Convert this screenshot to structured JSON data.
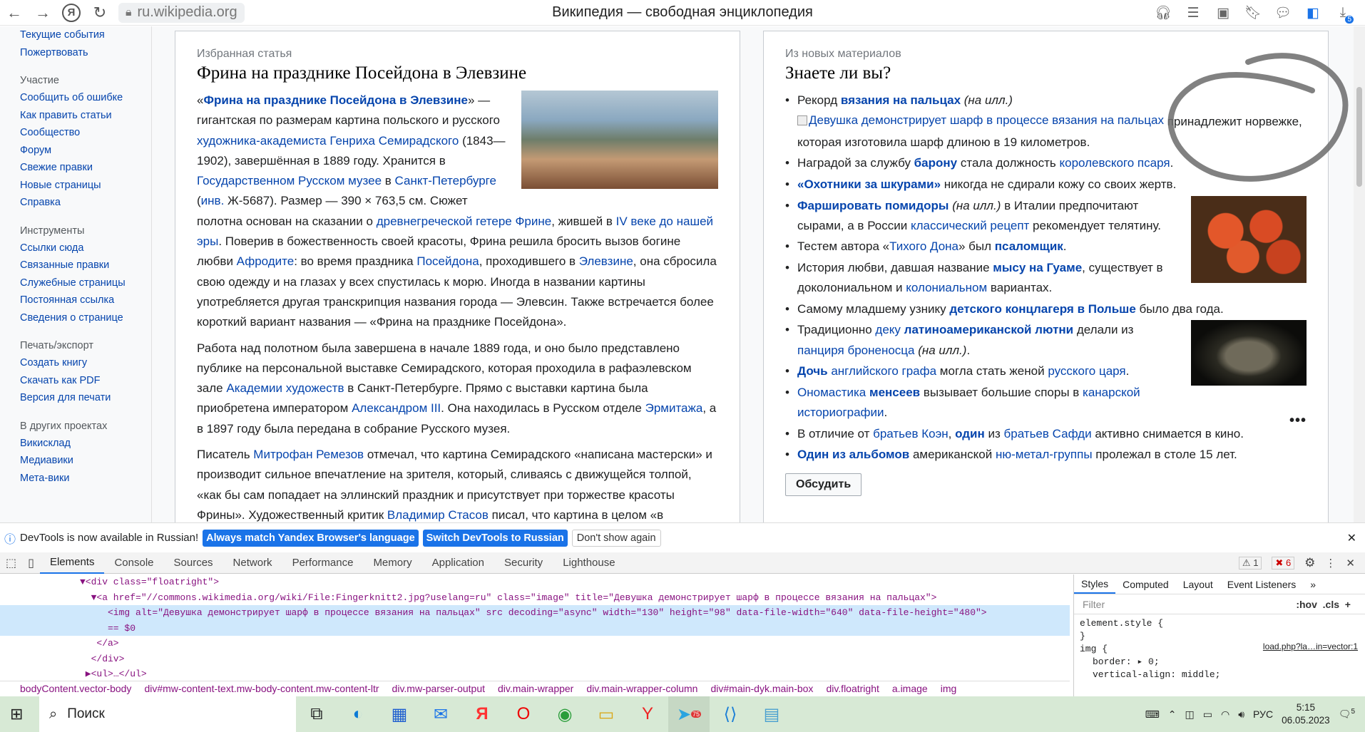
{
  "browser": {
    "url": "ru.wikipedia.org",
    "title": "Википедия — свободная энциклопедия",
    "downloads_badge": "5"
  },
  "sidebar": [
    {
      "type": "item",
      "label": "Текущие события"
    },
    {
      "type": "item",
      "label": "Пожертвовать"
    },
    {
      "type": "head",
      "label": "Участие"
    },
    {
      "type": "item",
      "label": "Сообщить об ошибке"
    },
    {
      "type": "item",
      "label": "Как править статьи"
    },
    {
      "type": "item",
      "label": "Сообщество"
    },
    {
      "type": "item",
      "label": "Форум"
    },
    {
      "type": "item",
      "label": "Свежие правки"
    },
    {
      "type": "item",
      "label": "Новые страницы"
    },
    {
      "type": "item",
      "label": "Справка"
    },
    {
      "type": "head",
      "label": "Инструменты"
    },
    {
      "type": "item",
      "label": "Ссылки сюда"
    },
    {
      "type": "item",
      "label": "Связанные правки"
    },
    {
      "type": "item",
      "label": "Служебные страницы"
    },
    {
      "type": "item",
      "label": "Постоянная ссылка"
    },
    {
      "type": "item",
      "label": "Сведения о странице"
    },
    {
      "type": "head",
      "label": "Печать/экспорт"
    },
    {
      "type": "item",
      "label": "Создать книгу"
    },
    {
      "type": "item",
      "label": "Скачать как PDF"
    },
    {
      "type": "item",
      "label": "Версия для печати"
    },
    {
      "type": "head",
      "label": "В других проектах"
    },
    {
      "type": "item",
      "label": "Викисклад"
    },
    {
      "type": "item",
      "label": "Медиавики"
    },
    {
      "type": "item",
      "label": "Мета-вики"
    }
  ],
  "featured": {
    "kicker": "Избранная статья",
    "title": "Фрина на празднике Посейдона в Элевзине",
    "paragraphs": [
      [
        {
          "t": "«"
        },
        {
          "b": "Фрина на празднике Посейдона в Элевзине"
        },
        {
          "t": "» — гигантская по размерам картина польского и русского "
        },
        {
          "a": "художника-академиста"
        },
        {
          "t": " "
        },
        {
          "a": "Генриха Семирадского"
        },
        {
          "t": " (1843—1902), завершённая в 1889 году. Хранится в "
        },
        {
          "a": "Государственном Русском музее"
        },
        {
          "t": " в "
        },
        {
          "a": "Санкт-Петербурге"
        },
        {
          "t": " ("
        },
        {
          "a": "инв."
        },
        {
          "t": " Ж-5687). Размер — 390 × 763,5 см. Сюжет полотна основан на сказании о "
        },
        {
          "a": "древнегреческой гетере Фрине"
        },
        {
          "t": ", жившей в "
        },
        {
          "a": "IV веке до нашей эры"
        },
        {
          "t": ". Поверив в божественность своей красоты, Фрина решила бросить вызов богине любви "
        },
        {
          "a": "Афродите"
        },
        {
          "t": ": во время праздника "
        },
        {
          "a": "Посейдона"
        },
        {
          "t": ", проходившего в "
        },
        {
          "a": "Элевзине"
        },
        {
          "t": ", она сбросила свою одежду и на глазах у всех спустилась к морю. Иногда в названии картины употребляется другая транскрипция названия города — Элевсин. Также встречается более короткий вариант названия — «Фрина на празднике Посейдона»."
        }
      ],
      [
        {
          "t": "Работа над полотном была завершена в начале 1889 года, и оно было представлено публике на персональной выставке Семирадского, которая проходила в рафаэлевском зале "
        },
        {
          "a": "Академии художеств"
        },
        {
          "t": " в Санкт-Петербурге. Прямо с выставки картина была приобретена императором "
        },
        {
          "a": "Александром III"
        },
        {
          "t": ". Она находилась в Русском отделе "
        },
        {
          "a": "Эрмитажа"
        },
        {
          "t": ", а в 1897 году была передана в собрание Русского музея."
        }
      ],
      [
        {
          "t": "Писатель "
        },
        {
          "a": "Митрофан Ремезов"
        },
        {
          "t": " отмечал, что картина Семирадского «написана мастерски» и производит сильное впечатление на зрителя, который, сливаясь с движущейся толпой, «как бы сам попадает на эллинский праздник и присутствует при торжестве красоты Фрины». Художественный критик "
        },
        {
          "a": "Владимир Стасов"
        },
        {
          "t": " писал, что картина в целом «в"
        }
      ]
    ]
  },
  "dyk": {
    "kicker": "Из новых материалов",
    "title": "Знаете ли вы?",
    "discuss": "Обсудить",
    "more": "•••",
    "items": [
      [
        {
          "t": "Рекорд "
        },
        {
          "b": "вязания на пальцах"
        },
        {
          "t": " "
        },
        {
          "i": "(на илл.)"
        },
        {
          "img": "Девушка демонстрирует шарф в процессе вязания на пальцах"
        },
        {
          "t": " принадлежит норвежке, которая изготовила шарф длиною в 19 километров."
        }
      ],
      [
        {
          "t": "Наградой за службу "
        },
        {
          "b": "барону"
        },
        {
          "t": " стала должность "
        },
        {
          "a": "королевского псаря"
        },
        {
          "t": "."
        }
      ],
      [
        {
          "b": "«Охотники за шкурами»"
        },
        {
          "t": " никогда не сдирали кожу со своих жертв."
        }
      ],
      [
        {
          "b": "Фаршировать помидоры"
        },
        {
          "t": " "
        },
        {
          "i": "(на илл.)"
        },
        {
          "t": " в Италии предпочитают сырами, а в России "
        },
        {
          "a": "классический рецепт"
        },
        {
          "t": " рекомендует телятину."
        }
      ],
      [
        {
          "t": "Тестем автора «"
        },
        {
          "a": "Тихого Дона"
        },
        {
          "t": "» был "
        },
        {
          "b": "псаломщик"
        },
        {
          "t": "."
        }
      ],
      [
        {
          "t": "История любви, давшая название "
        },
        {
          "b": "мысу на Гуаме"
        },
        {
          "t": ", существует в доколониальном и "
        },
        {
          "a": "колониальном"
        },
        {
          "t": " вариантах."
        }
      ],
      [
        {
          "t": "Самому младшему узнику "
        },
        {
          "b": "детского концлагеря в Польше"
        },
        {
          "t": " было два года."
        }
      ],
      [
        {
          "t": "Традиционно "
        },
        {
          "a": "деку"
        },
        {
          "t": " "
        },
        {
          "b": "латиноамериканской лютни"
        },
        {
          "t": " делали из "
        },
        {
          "a": "панциря броненосца"
        },
        {
          "t": " "
        },
        {
          "i": "(на илл.)"
        },
        {
          "t": "."
        }
      ],
      [
        {
          "b": "Дочь"
        },
        {
          "t": " "
        },
        {
          "a": "английского графа"
        },
        {
          "t": " могла стать женой "
        },
        {
          "a": "русского царя"
        },
        {
          "t": "."
        }
      ],
      [
        {
          "a": "Ономастика"
        },
        {
          "t": " "
        },
        {
          "b": "менсеев"
        },
        {
          "t": " вызывает большие споры в "
        },
        {
          "a": "канарской историографии"
        },
        {
          "t": "."
        }
      ],
      [
        {
          "t": "В отличие от "
        },
        {
          "a": "братьев Коэн"
        },
        {
          "t": ", "
        },
        {
          "b": "один"
        },
        {
          "t": " из "
        },
        {
          "a": "братьев Сафди"
        },
        {
          "t": " активно снимается в кино."
        }
      ],
      [
        {
          "b": "Один из альбомов"
        },
        {
          "t": " американской "
        },
        {
          "a": "ню-метал-группы"
        },
        {
          "t": " пролежал в столе 15 лет."
        }
      ]
    ]
  },
  "infobar": {
    "text": "DevTools is now available in Russian!",
    "btn1": "Always match Yandex Browser's language",
    "btn2": "Switch DevTools to Russian",
    "btn3": "Don't show again"
  },
  "devtools": {
    "tabs": [
      "Elements",
      "Console",
      "Sources",
      "Network",
      "Performance",
      "Memory",
      "Application",
      "Security",
      "Lighthouse"
    ],
    "warn": "1",
    "err": "6",
    "dom": [
      "▼<div class=\"floatright\">",
      "  ▼<a href=\"//commons.wikimedia.org/wiki/File:Fingerknitt2.jpg?uselang=ru\" class=\"image\" title=\"Девушка демонстрирует шарф в процессе вязания на пальцах\">",
      "     <img alt=\"Девушка демонстрирует шарф в процессе вязания на пальцах\" src decoding=\"async\" width=\"130\" height=\"98\" data-file-width=\"640\" data-file-height=\"480\">",
      "     == $0",
      "   </a>",
      "  </div>",
      " ▶<ul>…</ul>"
    ],
    "crumbs": [
      "bodyContent.vector-body",
      "div#mw-content-text.mw-body-content.mw-content-ltr",
      "div.mw-parser-output",
      "div.main-wrapper",
      "div.main-wrapper-column",
      "div#main-dyk.main-box",
      "div.floatright",
      "a.image",
      "img"
    ],
    "styletabs": [
      "Styles",
      "Computed",
      "Layout",
      "Event Listeners",
      "»"
    ],
    "filter": "Filter",
    "hov": ":hov",
    ".cls": ".cls",
    "rules": [
      "element.style {",
      "}",
      "img {",
      "border: ▸ 0;",
      "vertical-align: middle;"
    ],
    "rule_source": "load.php?la…in=vector:1"
  },
  "taskbar": {
    "search": "Поиск",
    "lang": "РУС",
    "time": "5:15",
    "date": "06.05.2023",
    "notif": "5",
    "tg_badge": "75"
  }
}
